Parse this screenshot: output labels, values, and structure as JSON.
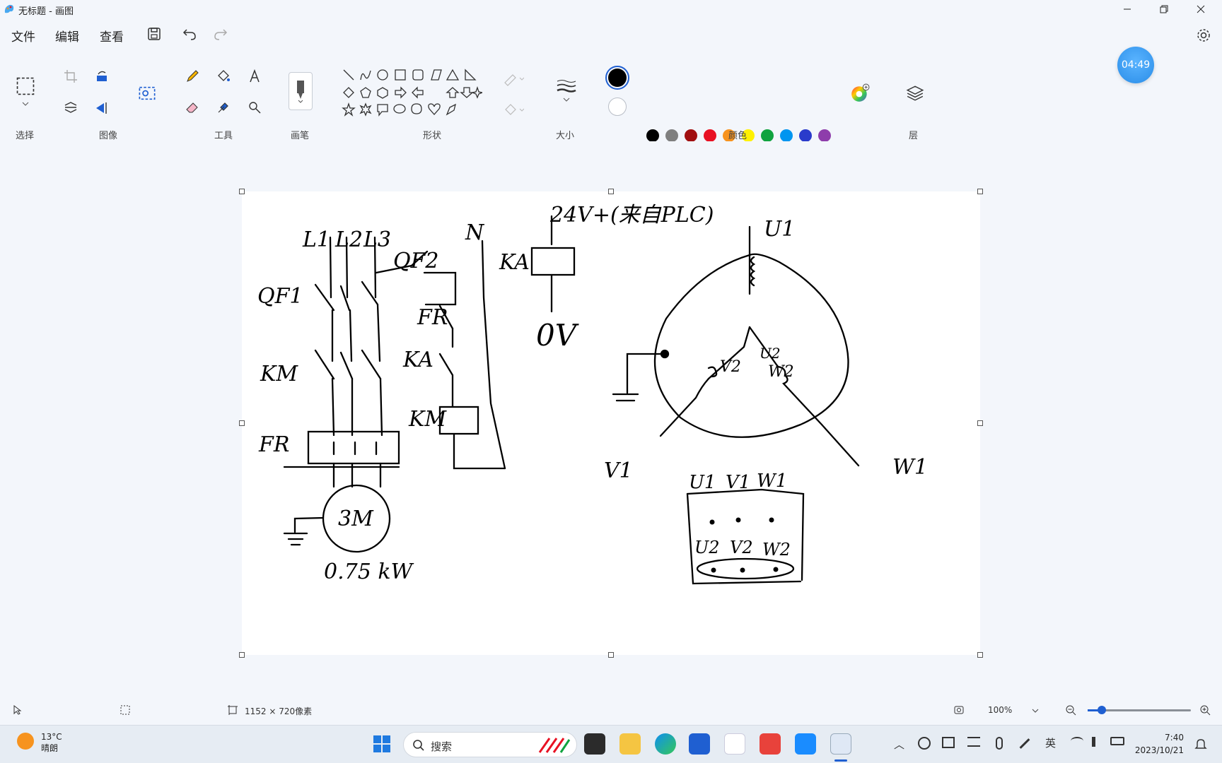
{
  "window": {
    "title": "无标题 - 画图"
  },
  "menu": {
    "file": "文件",
    "edit": "编辑",
    "view": "查看"
  },
  "groups": {
    "select": "选择",
    "image": "图像",
    "tools": "工具",
    "brush": "画笔",
    "shapes": "形状",
    "size": "大小",
    "colors": "颜色",
    "layers": "层"
  },
  "timer": "04:49",
  "colors": {
    "primary": "#000000",
    "secondary": "#ffffff",
    "row1": [
      "#000000",
      "#7f7f7f",
      "#a10f10",
      "#e81123",
      "#f7931e",
      "#fff100",
      "#10a33f",
      "#0095f0",
      "#2a3bcb",
      "#8e3dab"
    ],
    "row2": [
      "#ffffff",
      "#c3c3c3",
      "#b97a56",
      "#f5b6c8",
      "#ffc90e",
      "#efe4b0",
      "#b5e61d",
      "#99d9ea",
      "#7092be",
      "#c8bfe7"
    ]
  },
  "drawing": {
    "phases": [
      "L1",
      "L2",
      "L3"
    ],
    "neutral": "N",
    "breaker_main": "QF1",
    "breaker_ctrl": "QF2",
    "contactor": "KM",
    "overload": "FR",
    "relay": "KA",
    "motor": "3M",
    "motor_power": "0.75 kW",
    "supply": "24V+(来自PLC)",
    "zero": "0V",
    "terminals_top": [
      "U1",
      "V1",
      "W1"
    ],
    "terminals_bottom": [
      "U2",
      "V2",
      "W2"
    ]
  },
  "status": {
    "canvas_size": "1152 × 720像素",
    "zoom": "100%"
  },
  "taskbar": {
    "weather_temp": "13°C",
    "weather_desc": "晴朗",
    "search": "搜索",
    "ime": "英",
    "time": "7:40",
    "date": "2023/10/21"
  }
}
